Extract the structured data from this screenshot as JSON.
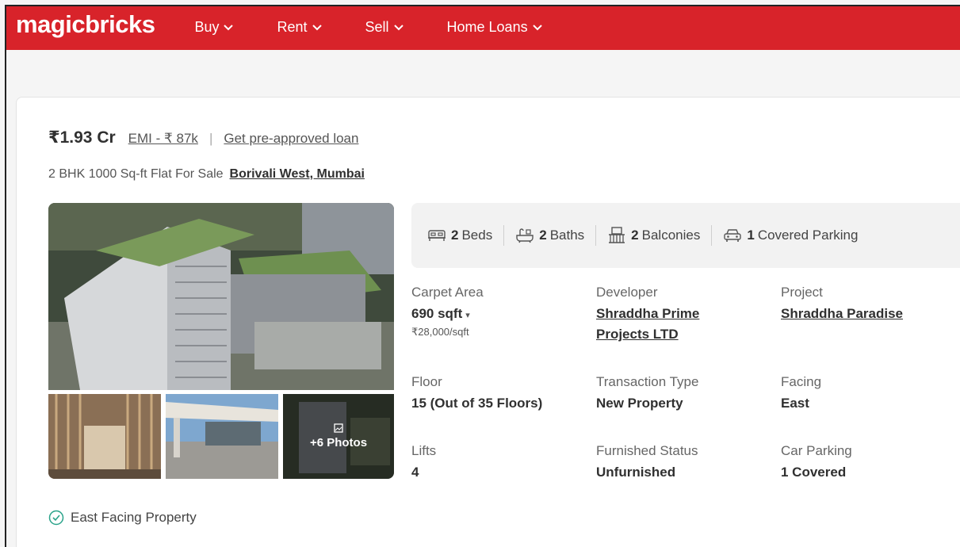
{
  "navbar": {
    "logo": "magicbricks",
    "items": [
      {
        "label": "Buy"
      },
      {
        "label": "Rent"
      },
      {
        "label": "Sell"
      },
      {
        "label": "Home Loans"
      }
    ],
    "color": "#d8232a"
  },
  "listing": {
    "price": "₹1.93 Cr",
    "emi": "EMI - ₹ 87k",
    "separator": "|",
    "loan_link": "Get pre-approved loan",
    "title": "2 BHK 1000 Sq-ft Flat For Sale",
    "locality": "Borivali West, Mumbai"
  },
  "gallery": {
    "more_photos": "+6 Photos"
  },
  "amenities": [
    {
      "count": "2",
      "label": "Beds",
      "icon": "bed-icon"
    },
    {
      "count": "2",
      "label": "Baths",
      "icon": "bath-icon"
    },
    {
      "count": "2",
      "label": "Balconies",
      "icon": "balcony-icon"
    },
    {
      "count": "1",
      "label": "Covered Parking",
      "icon": "car-icon"
    }
  ],
  "details": {
    "carpet_area": {
      "label": "Carpet Area",
      "value": "690 sqft",
      "sub": "₹28,000/sqft"
    },
    "developer": {
      "label": "Developer",
      "value_line1": "Shraddha Prime",
      "value_line2": "Projects LTD"
    },
    "project": {
      "label": "Project",
      "value": "Shraddha Paradise"
    },
    "floor": {
      "label": "Floor",
      "value": "15 (Out of 35 Floors)"
    },
    "transaction_type": {
      "label": "Transaction Type",
      "value": "New Property"
    },
    "facing": {
      "label": "Facing",
      "value": "East"
    },
    "lifts": {
      "label": "Lifts",
      "value": "4"
    },
    "furnished_status": {
      "label": "Furnished Status",
      "value": "Unfurnished"
    },
    "car_parking": {
      "label": "Car Parking",
      "value": "1 Covered"
    }
  },
  "highlight": {
    "text": "East Facing Property",
    "icon": "check-circle-icon",
    "color": "#2aa38a"
  }
}
